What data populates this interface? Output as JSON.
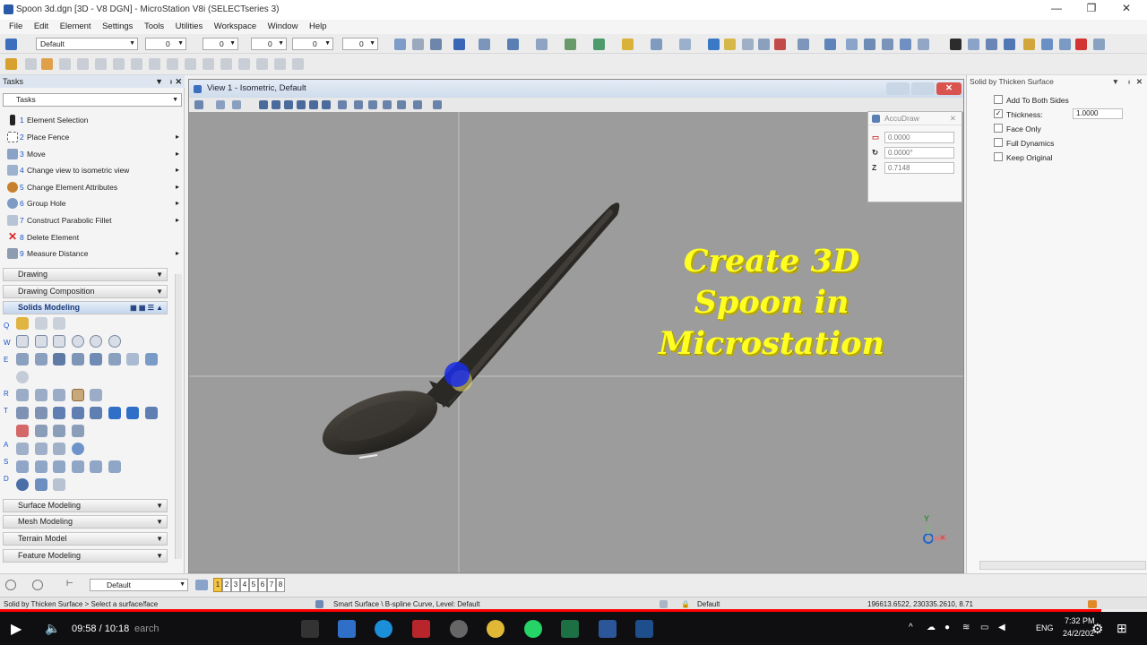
{
  "window": {
    "title": "Spoon 3d.dgn [3D - V8 DGN] - MicroStation V8i (SELECTseries 3)",
    "controls": [
      "—",
      "❐",
      "✕"
    ]
  },
  "menu": [
    "File",
    "Edit",
    "Element",
    "Settings",
    "Tools",
    "Utilities",
    "Workspace",
    "Window",
    "Help"
  ],
  "attributes": {
    "level": "Default",
    "color_val": "0",
    "style_val": "0",
    "weight_val": "0",
    "transparency_val": "0",
    "priority_val": "0"
  },
  "tasks": {
    "header": "Tasks",
    "selector": "Tasks",
    "items": [
      {
        "num": "1",
        "label": "Element Selection"
      },
      {
        "num": "2",
        "label": "Place Fence"
      },
      {
        "num": "3",
        "label": "Move"
      },
      {
        "num": "4",
        "label": "Change view to isometric view"
      },
      {
        "num": "5",
        "label": "Change Element Attributes"
      },
      {
        "num": "6",
        "label": "Group Hole"
      },
      {
        "num": "7",
        "label": "Construct Parabolic Fillet"
      },
      {
        "num": "8",
        "label": "Delete Element"
      },
      {
        "num": "9",
        "label": "Measure Distance"
      }
    ],
    "sections": [
      "Drawing",
      "Drawing Composition"
    ],
    "active_section": "Solids Modeling",
    "row_letters": [
      "Q",
      "W",
      "E",
      "R",
      "T",
      "A",
      "S",
      "D"
    ],
    "lower_sections": [
      "Surface Modeling",
      "Mesh Modeling",
      "Terrain Model",
      "Feature Modeling"
    ]
  },
  "view": {
    "title": "View 1 - Isometric, Default"
  },
  "accudraw": {
    "title": "AccuDraw",
    "x_label": "",
    "x_value": "0.0000",
    "angle_label": "",
    "angle_value": "0.0000°",
    "z_label": "Z",
    "z_value": "0.7148"
  },
  "overlay": {
    "line1": "Create 3D",
    "line2": "Spoon in",
    "line3": "Microstation"
  },
  "triad": {
    "y": "Y"
  },
  "tool_settings": {
    "title": "Solid by Thicken Surface",
    "add_to_both_sides": "Add To Both Sides",
    "thickness_label": "Thickness:",
    "thickness_value": "1.0000",
    "face_only": "Face Only",
    "full_dynamics": "Full Dynamics",
    "keep_original": "Keep Original"
  },
  "bottom": {
    "level": "Default",
    "view_numbers": [
      "1",
      "2",
      "3",
      "4",
      "5",
      "6",
      "7",
      "8"
    ]
  },
  "status": {
    "prompt": "Solid by Thicken Surface > Select a surface/face",
    "message": "Smart Surface \\ B-spline Curve, Level: Default",
    "level": "Default",
    "coords": "196613.6522, 230335.2610, 8.71"
  },
  "player": {
    "time": "09:58 / 10:18",
    "search": "earch",
    "lang": "ENG",
    "clock_time": "7:32 PM",
    "clock_date": "24/2/202",
    "progress": 0.96
  },
  "colors": {
    "accent": "#1a56c8",
    "overlay_text": "#ffff22",
    "progress": "#ff0000"
  }
}
